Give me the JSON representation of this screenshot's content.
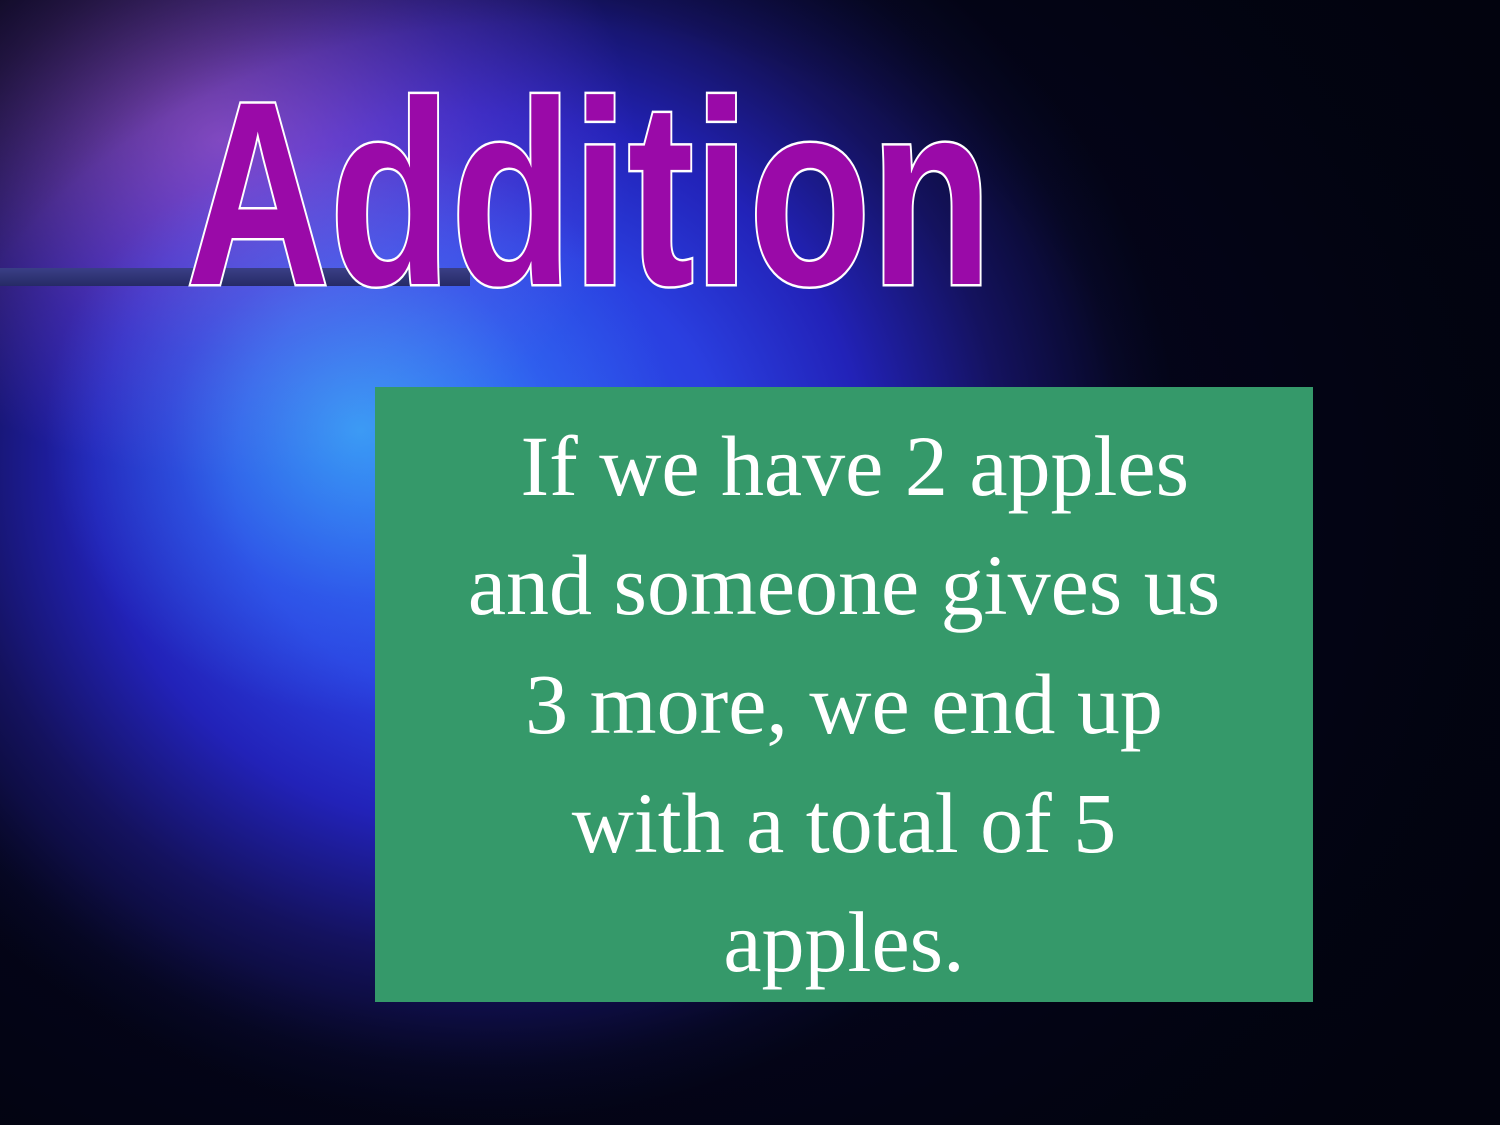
{
  "slide": {
    "title": "Addition",
    "body_lines": [
      " If we have 2 apples",
      "and someone gives us",
      "3 more, we end up",
      "with a total of 5",
      "apples."
    ]
  },
  "colors": {
    "title_fill": "#9a0aa8",
    "title_outline": "#ffffff",
    "box_background": "#35996a",
    "body_text": "#ffffff",
    "background_primary": "#2a3fe0",
    "rule_line": "#2c3070"
  }
}
